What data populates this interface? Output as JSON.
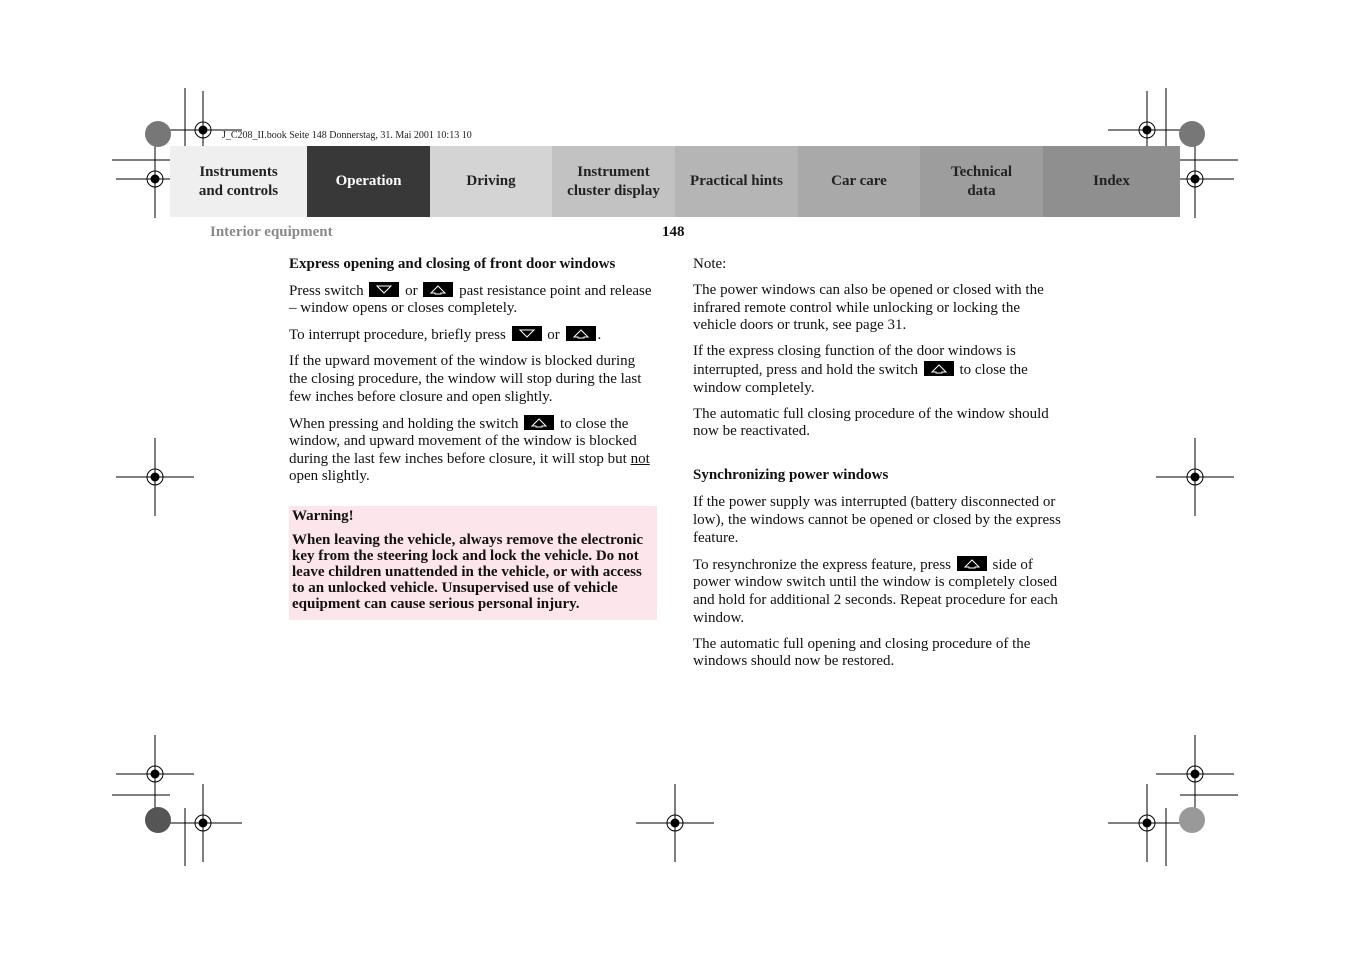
{
  "header": {
    "book_line": "J_C208_II.book  Seite 148  Donnerstag, 31. Mai 2001  10:13 10",
    "tabs": [
      {
        "label": "Instruments and controls",
        "bg": "#efefef",
        "fg": "#222222",
        "active": false
      },
      {
        "label": "Operation",
        "bg": "#383838",
        "fg": "#ffffff",
        "active": true
      },
      {
        "label": "Driving",
        "bg": "#d4d4d4",
        "fg": "#222222",
        "active": false
      },
      {
        "label": "Instrument cluster display",
        "bg": "#c2c2c2",
        "fg": "#222222",
        "active": false
      },
      {
        "label": "Practical hints",
        "bg": "#b5b5b5",
        "fg": "#222222",
        "active": false
      },
      {
        "label": "Car care",
        "bg": "#a9a9a9",
        "fg": "#222222",
        "active": false
      },
      {
        "label": "Technical data",
        "bg": "#9d9d9d",
        "fg": "#222222",
        "active": false
      },
      {
        "label": "Index",
        "bg": "#8f8f8f",
        "fg": "#222222",
        "active": false
      }
    ],
    "section": "Interior equipment",
    "page_number": "148"
  },
  "left": {
    "heading": "Express opening and closing of front door windows",
    "p1": {
      "a": "Press switch",
      "b": "or",
      "c": "past resistance point and release – window opens or closes completely."
    },
    "p2": {
      "a": "To interrupt procedure, briefly press",
      "b": "or",
      "c": "."
    },
    "p3": "If the upward movement of the window is blocked during the closing procedure, the window will stop during the last few inches before closure and open slightly.",
    "p4": {
      "a": "When pressing and holding the switch",
      "b": "to close the window, and upward movement of the window is blocked during the last few inches before closure, it will stop but",
      "c": "not",
      "d": "open slightly."
    },
    "warning": {
      "title": "Warning!",
      "text": "When leaving the vehicle, always remove the electronic key from the steering lock and lock the vehicle. Do not leave children unattended in the vehicle, or with access to an unlocked vehicle. Unsupervised use of vehicle equipment can cause serious personal injury.",
      "bg": "#fde5ec"
    }
  },
  "right": {
    "note_label": "Note:",
    "n1": "The power windows can also be opened or closed with the infrared remote control while unlocking or locking the vehicle doors or trunk, see page 31.",
    "n2": {
      "a": "If the express closing function of the door windows is interrupted, press and hold the switch",
      "b": "to close the window completely."
    },
    "n3": "The automatic full closing procedure of the window should now be reactivated.",
    "heading": "Synchronizing power windows",
    "s1": "If the power supply was interrupted (battery disconnected or low), the windows cannot be opened or closed by the express feature.",
    "s2": {
      "a": "To resynchronize the express feature, press",
      "b": "side of power window switch until the window is completely closed and hold for additional 2 seconds. Repeat procedure for each window."
    },
    "s3": "The automatic full opening and closing procedure of the windows should now be restored."
  },
  "icons": {
    "down": "window-down-switch-icon",
    "up": "window-up-switch-icon"
  }
}
